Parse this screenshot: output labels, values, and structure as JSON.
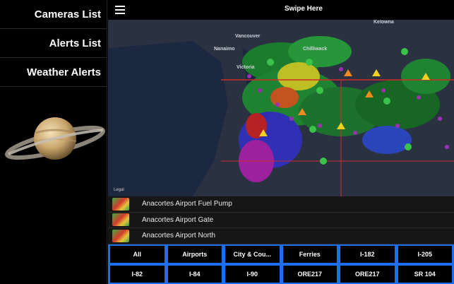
{
  "sidebar": {
    "items": [
      {
        "label": "Cameras List"
      },
      {
        "label": "Alerts List"
      },
      {
        "label": "Weather Alerts"
      }
    ]
  },
  "topbar": {
    "title": "Swipe Here"
  },
  "map": {
    "cities": [
      "Vancouver",
      "Kelowna",
      "Nanaimo",
      "Chilliwack",
      "Victoria"
    ],
    "legal": "Legal"
  },
  "cameras": [
    {
      "name": "Anacortes Airport Fuel Pump"
    },
    {
      "name": "Anacortes Airport Gate"
    },
    {
      "name": "Anacortes Airport North"
    }
  ],
  "filters": [
    "All",
    "Airports",
    "City & Cou...",
    "Ferries",
    "I-182",
    "I-205",
    "I-82",
    "I-84",
    "I-90",
    "ORE217",
    "ORE217",
    "SR 104"
  ],
  "colors": {
    "accent": "#1d6ff0"
  }
}
